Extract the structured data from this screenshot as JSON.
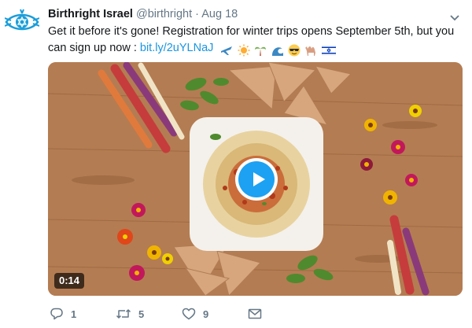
{
  "tweet": {
    "author_name": "Birthright Israel",
    "author_handle": "@birthright",
    "separator": "·",
    "timestamp": "Aug 18",
    "text": "Get it before it's gone! Registration for winter trips opens September 5th, but you can sign up now : ",
    "link_text": "bit.ly/2uYLNaJ",
    "emojis": [
      "airplane-icon",
      "sun-icon",
      "palm-tree-icon",
      "wave-icon",
      "sunglasses-face-icon",
      "camel-icon",
      "israel-flag-icon"
    ]
  },
  "media": {
    "type": "video",
    "duration": "0:14",
    "subject": "hummus-plate",
    "play_button_color": "#1da1f2"
  },
  "actions": {
    "reply_count": "1",
    "retweet_count": "5",
    "like_count": "9"
  },
  "colors": {
    "link": "#1b95e0",
    "secondary_text": "#657786",
    "avatar_blue": "#1b9dd9"
  }
}
